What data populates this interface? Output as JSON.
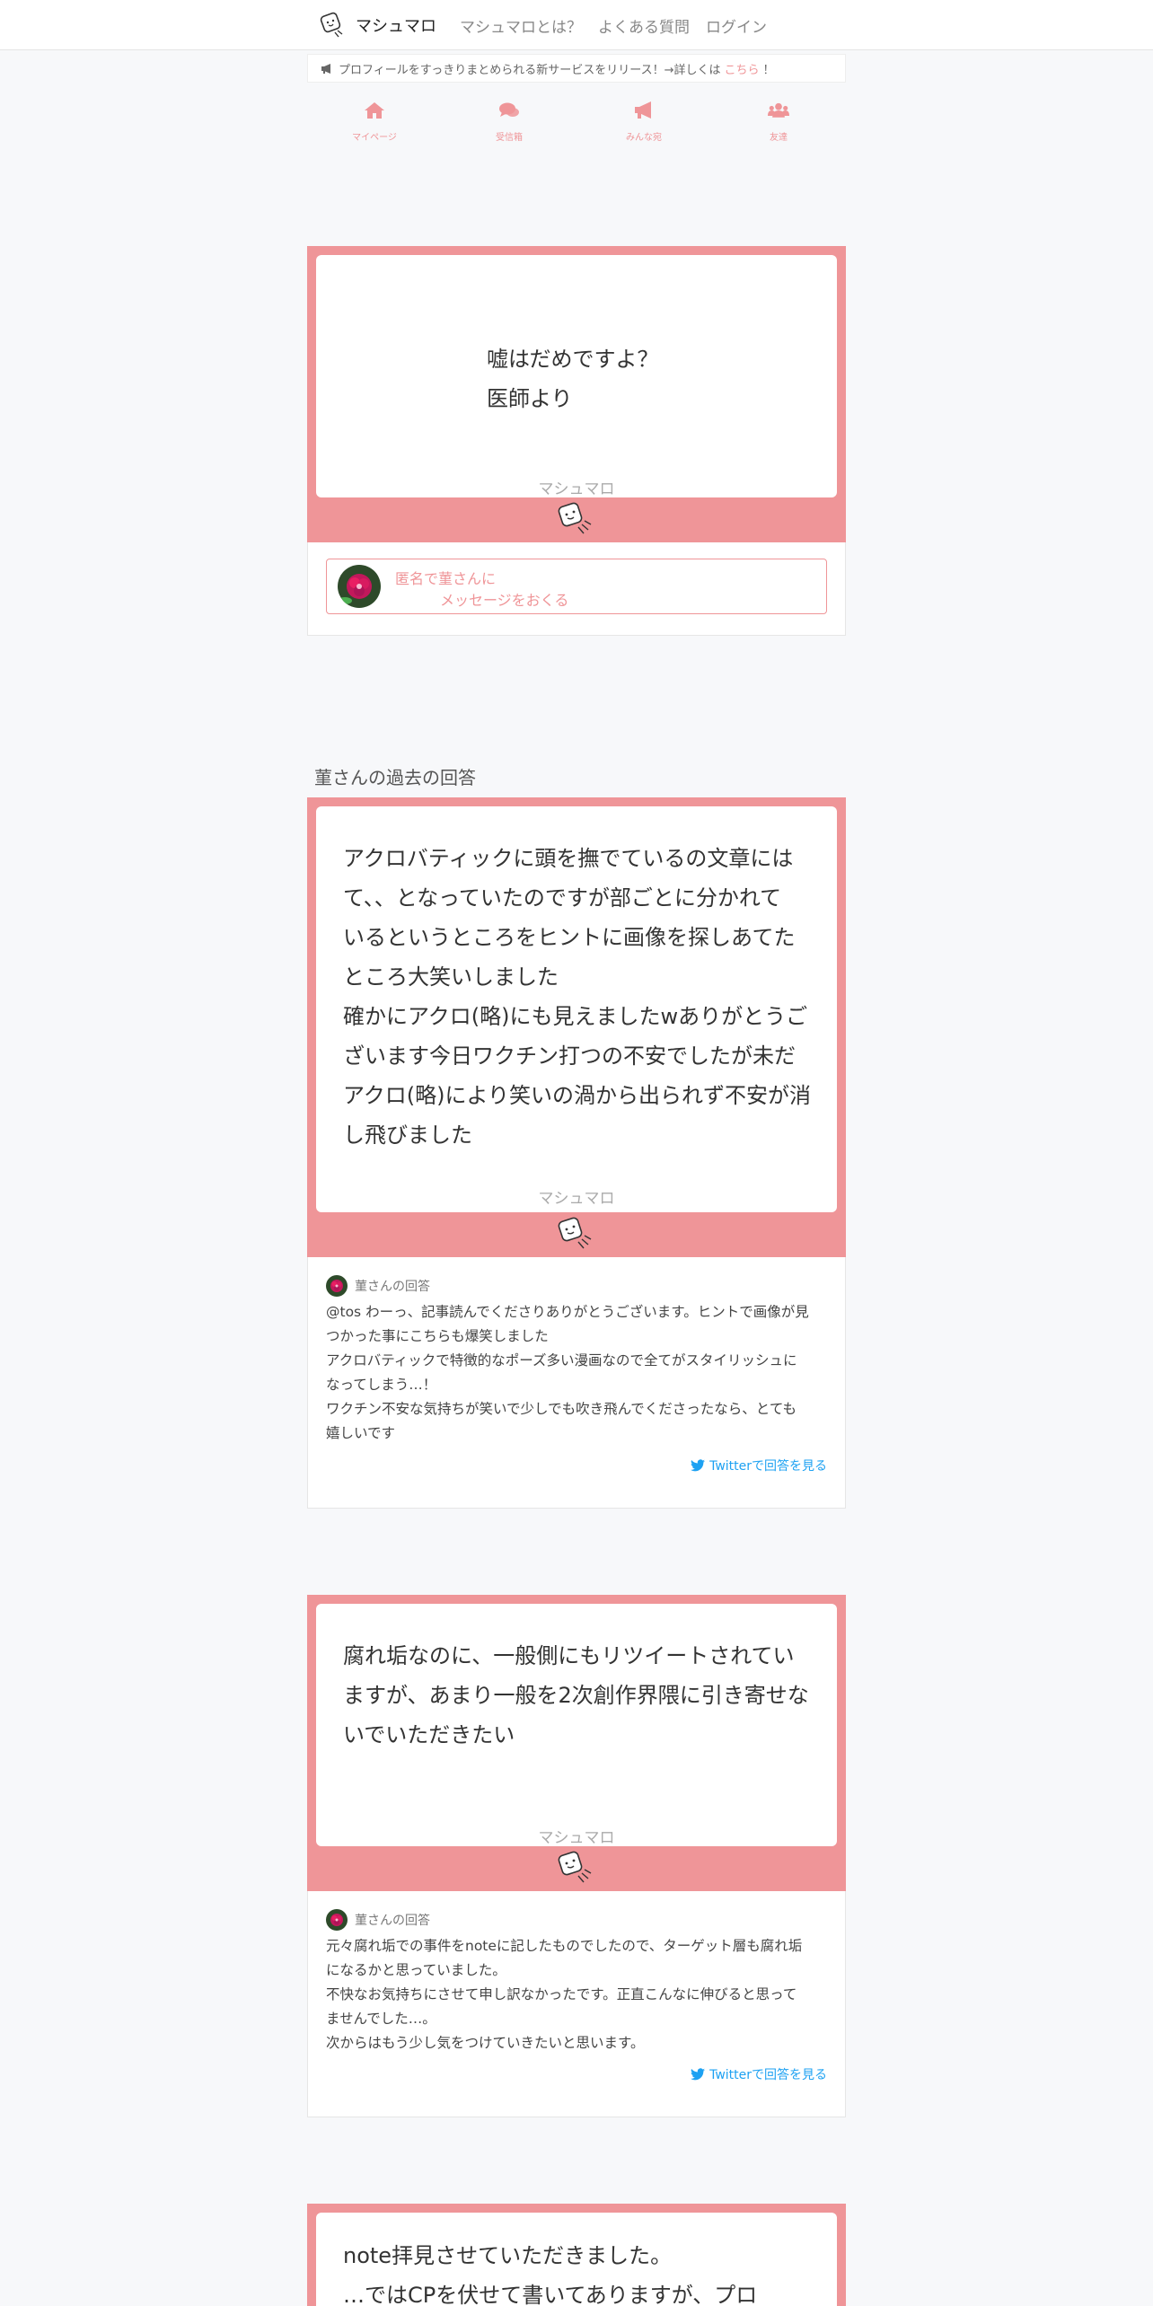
{
  "nav": {
    "brand": "マシュマロ",
    "links": [
      "マシュマロとは？",
      "よくある質問",
      "ログイン"
    ]
  },
  "announce": {
    "text": "プロフィールをすっきりまとめられる新サービスをリリース！→詳しくは",
    "link": "こちら",
    "suffix": "！"
  },
  "tabs": [
    {
      "label": "マイページ",
      "icon": "home-icon"
    },
    {
      "label": "受信箱",
      "icon": "comments-icon"
    },
    {
      "label": "みんな宛",
      "icon": "bullhorn-icon"
    },
    {
      "label": "友達",
      "icon": "users-icon"
    }
  ],
  "top_message": {
    "lines": [
      "嘘はだめですよ？",
      "医師より"
    ],
    "signature": "マシュマロ"
  },
  "send": {
    "line1": "匿名で菫さんに",
    "line2": "メッセージをおくる"
  },
  "section_title": "菫さんの過去の回答",
  "answers": [
    {
      "question_lines": [
        "アクロバティックに頭を撫でているの文章には",
        "て、、となっていたのですが部ごとに分かれて",
        "いるというところをヒントに画像を探しあてた",
        "ところ大笑いしました",
        "確かにアクロ(略)にも見えましたwありがとうご",
        "ざいます今日ワクチン打つの不安でしたが未だ",
        "アクロ(略)により笑いの渦から出られず不安が消",
        "し飛びました"
      ],
      "signature": "マシュマロ",
      "answer_label": "菫さんの回答",
      "answer_lines": [
        "@tos わーっ、記事読んでくださりありがとうございます。ヒントで画像が見",
        "つかった事にこちらも爆笑しました",
        "アクロバティックで特徴的なポーズ多い漫画なので全てがスタイリッシュに",
        "なってしまう…！",
        "ワクチン不安な気持ちが笑いで少しでも吹き飛んでくださったなら、とても",
        "嬉しいです"
      ],
      "twitter_link": "Twitterで回答を見る"
    },
    {
      "question_lines": [
        "腐れ垢なのに、一般側にもリツイートされてい",
        "ますが、あまり一般を2次創作界隈に引き寄せな",
        "いでいただきたい"
      ],
      "signature": "マシュマロ",
      "answer_label": "菫さんの回答",
      "answer_lines": [
        "元々腐れ垢での事件をnoteに記したものでしたので、ターゲット層も腐れ垢",
        "になるかと思っていました。",
        "不快なお気持ちにさせて申し訳なかったです。正直こんなに伸びると思って",
        "ませんでした…。",
        "次からはもう少し気をつけていきたいと思います。"
      ],
      "twitter_link": "Twitterで回答を見る"
    },
    {
      "question_lines": [
        "note拝見させていただきました。",
        "…ではCPを伏せて書いてありますが、プロ"
      ]
    }
  ],
  "colors": {
    "accent": "#ef9598",
    "twitter": "#1da1f2",
    "background": "#f7f8fa"
  }
}
